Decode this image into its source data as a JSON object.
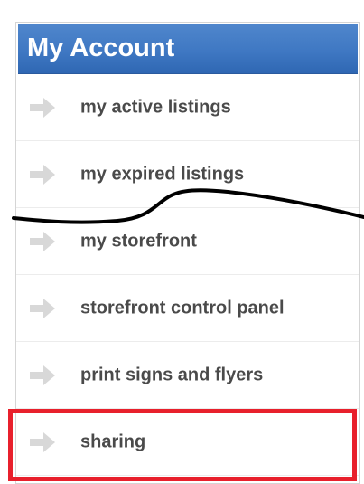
{
  "panel": {
    "title": "My Account"
  },
  "menu": {
    "items": [
      {
        "label": "my active listings",
        "icon": "arrow-right-icon"
      },
      {
        "label": "my expired listings",
        "icon": "arrow-right-icon"
      },
      {
        "label": "my storefront",
        "icon": "arrow-right-icon"
      },
      {
        "label": "storefront control panel",
        "icon": "arrow-right-icon"
      },
      {
        "label": "print signs and flyers",
        "icon": "arrow-right-icon"
      },
      {
        "label": "sharing",
        "icon": "arrow-right-icon"
      }
    ]
  },
  "colors": {
    "header": "#3f78c3",
    "label": "#4a4a4a",
    "icon": "#d8d8d8",
    "highlight": "#e8202c",
    "annotation": "#000000"
  }
}
